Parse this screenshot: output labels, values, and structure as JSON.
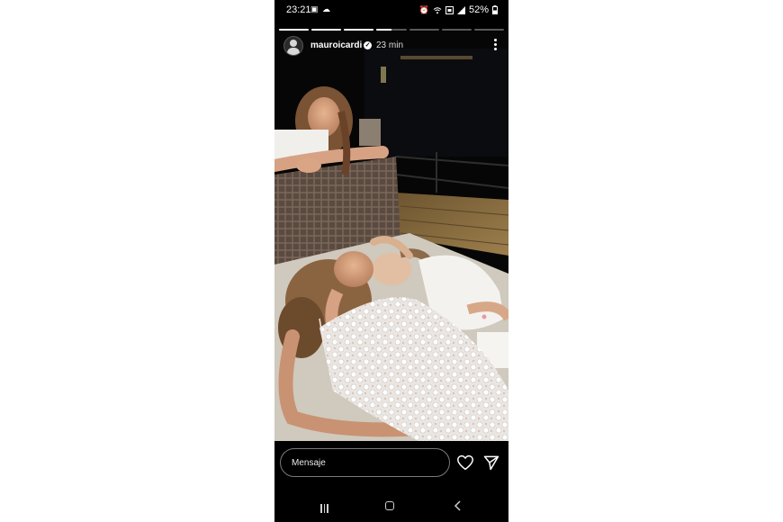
{
  "status_bar": {
    "time": "23:21",
    "left_icons": [
      "image-icon",
      "cloud-icon"
    ],
    "right_icons": [
      "alarm-icon",
      "wifi-icon",
      "sim-icon",
      "signal-icon"
    ],
    "battery": "52%"
  },
  "story": {
    "segments_total": 7,
    "active_segment": 4,
    "active_progress": 0.5,
    "username": "mauroicardi",
    "verified": true,
    "time_ago": "23 min"
  },
  "reply_bar": {
    "placeholder": "Mensaje"
  },
  "icons": {
    "more": "more-vertical-icon",
    "like": "heart-icon",
    "share": "send-icon",
    "nav_recents": "recents-icon",
    "nav_home": "home-icon",
    "nav_back": "back-icon"
  },
  "colors": {
    "background": "#000000",
    "text": "#ffffff",
    "input_border": "#7a7a7a"
  }
}
